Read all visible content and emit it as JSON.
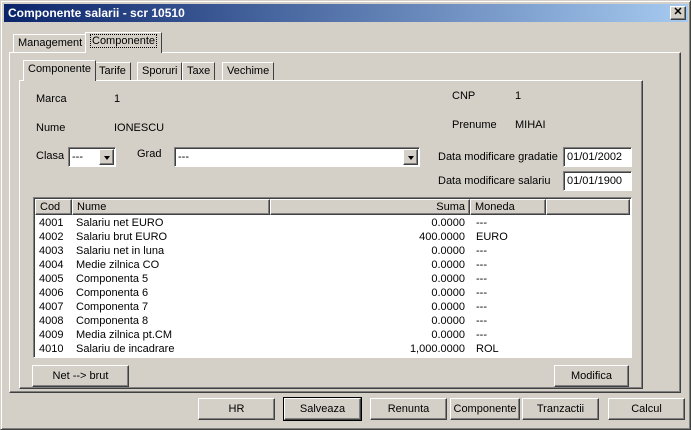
{
  "window": {
    "title": "Componente salarii - scr 10510",
    "close_glyph": "✕"
  },
  "outer_tabs": [
    {
      "label": "Management"
    },
    {
      "label": "Componente"
    }
  ],
  "inner_tabs": [
    {
      "label": "Componente"
    },
    {
      "label": "Tarife"
    },
    {
      "label": "Sporuri"
    },
    {
      "label": "Taxe"
    },
    {
      "label": "Vechime"
    }
  ],
  "form": {
    "marca_label": "Marca",
    "marca_value": "1",
    "cnp_label": "CNP",
    "cnp_value": "1",
    "nume_label": "Nume",
    "nume_value": "IONESCU",
    "prenume_label": "Prenume",
    "prenume_value": "MIHAI",
    "clasa_label": "Clasa",
    "clasa_value": "---",
    "grad_label": "Grad",
    "grad_value": "---",
    "data_gradatie_label": "Data modificare gradatie",
    "data_gradatie_value": "01/01/2002",
    "data_salariu_label": "Data modificare salariu",
    "data_salariu_value": "01/01/1900"
  },
  "table": {
    "columns": [
      "Cod",
      "Nume",
      "Suma",
      "Moneda"
    ],
    "rows": [
      {
        "cod": "4001",
        "nume": "Salariu net EURO",
        "suma": "0.0000",
        "moneda": "---"
      },
      {
        "cod": "4002",
        "nume": "Salariu brut EURO",
        "suma": "400.0000",
        "moneda": "EURO"
      },
      {
        "cod": "4003",
        "nume": "Salariu net in luna",
        "suma": "0.0000",
        "moneda": "---"
      },
      {
        "cod": "4004",
        "nume": "Medie zilnica CO",
        "suma": "0.0000",
        "moneda": "---"
      },
      {
        "cod": "4005",
        "nume": "Componenta 5",
        "suma": "0.0000",
        "moneda": "---"
      },
      {
        "cod": "4006",
        "nume": "Componenta 6",
        "suma": "0.0000",
        "moneda": "---"
      },
      {
        "cod": "4007",
        "nume": "Componenta 7",
        "suma": "0.0000",
        "moneda": "---"
      },
      {
        "cod": "4008",
        "nume": "Componenta 8",
        "suma": "0.0000",
        "moneda": "---"
      },
      {
        "cod": "4009",
        "nume": "Media zilnica pt.CM",
        "suma": "0.0000",
        "moneda": "---"
      },
      {
        "cod": "4010",
        "nume": "Salariu de incadrare",
        "suma": "1,000.0000",
        "moneda": "ROL"
      }
    ]
  },
  "panel_buttons": {
    "net_brut": "Net --> brut",
    "modifica": "Modifica"
  },
  "footer_buttons": {
    "hr": "HR",
    "salveaza": "Salveaza",
    "renunta": "Renunta",
    "componente": "Componente",
    "tranzactii": "Tranzactii",
    "calcul": "Calcul"
  },
  "icons": {
    "combo_arrow": "chevron-down-icon",
    "close": "close-icon"
  },
  "colors": {
    "title_start": "#0a246a",
    "title_end": "#a6caf0",
    "face": "#d4d0c8"
  }
}
